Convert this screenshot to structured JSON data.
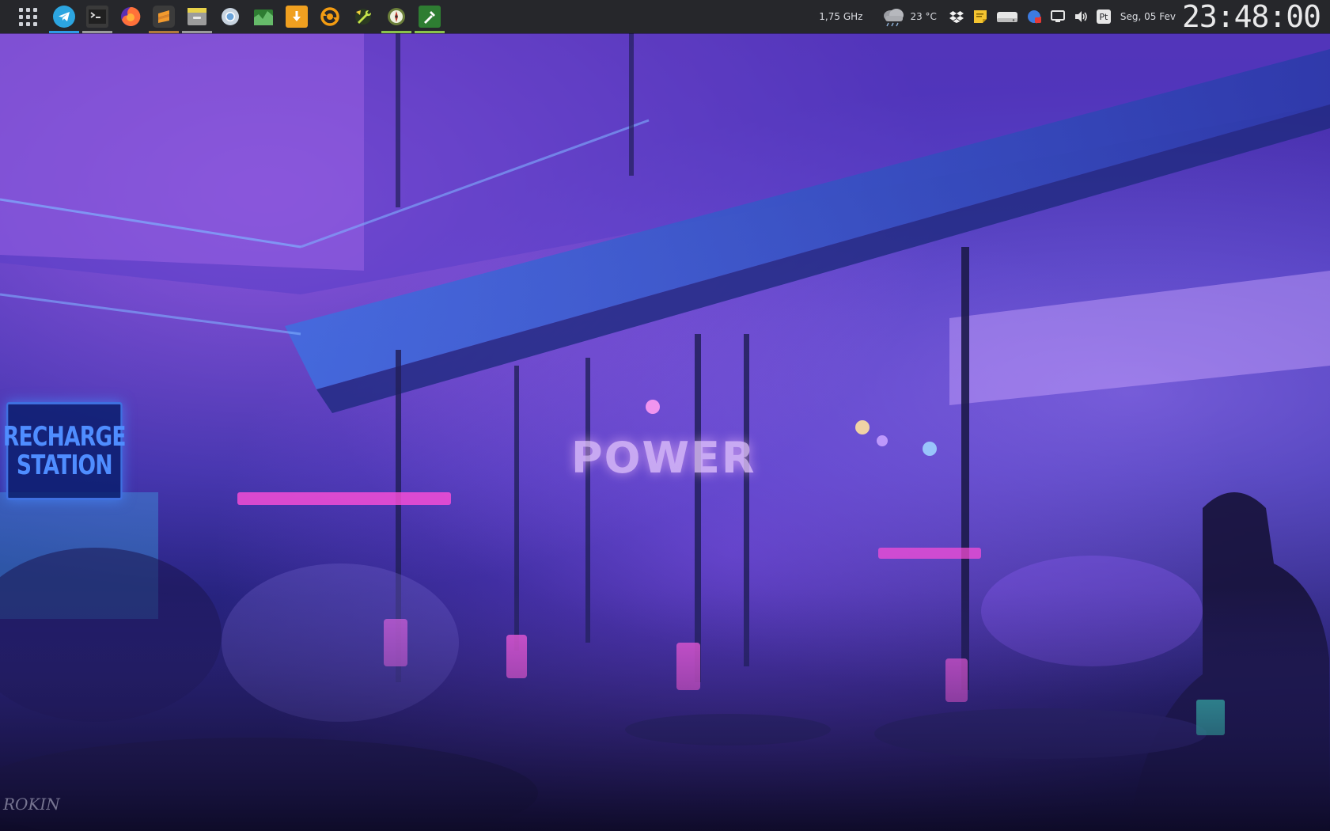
{
  "panel": {
    "launcher_icon": "app-grid-icon",
    "tasks": [
      {
        "name": "telegram",
        "icon": "telegram-icon",
        "color": "#2ca5e0",
        "active": true,
        "indicator": "#2e9be6"
      },
      {
        "name": "terminal",
        "icon": "terminal-icon",
        "color": "#2b2b2b",
        "active": true,
        "indicator": "#9a9a9a"
      },
      {
        "name": "firefox",
        "icon": "firefox-icon",
        "color": "#ff7139",
        "active": false,
        "indicator": "#9a9a9a"
      },
      {
        "name": "sublime-text",
        "icon": "sublime-text-icon",
        "color": "#f29a2e",
        "active": true,
        "indicator": "#b07a3a"
      },
      {
        "name": "file-manager",
        "icon": "file-manager-icon",
        "color": "#9c9c9c",
        "active": true,
        "indicator": "#9a9a9a"
      },
      {
        "name": "chromium",
        "icon": "chromium-icon",
        "color": "#6aa3d9",
        "active": false,
        "indicator": "#9a9a9a"
      },
      {
        "name": "system-monitor",
        "icon": "system-monitor-icon",
        "color": "#4caf50",
        "active": false,
        "indicator": "#9a9a9a"
      },
      {
        "name": "download-manager",
        "icon": "download-icon",
        "color": "#f0a020",
        "active": false,
        "indicator": "#9a9a9a"
      },
      {
        "name": "update-manager",
        "icon": "update-icon",
        "color": "#f39c12",
        "active": false,
        "indicator": "#9a9a9a"
      },
      {
        "name": "wrench-tool",
        "icon": "wrench-icon",
        "color": "#8bc34a",
        "active": false,
        "indicator": "#9a9a9a"
      },
      {
        "name": "compass-app",
        "icon": "compass-icon",
        "color": "#8bc34a",
        "active": true,
        "indicator": "#8bc34a"
      },
      {
        "name": "tools-app",
        "icon": "tools-icon",
        "color": "#2e7d32",
        "active": true,
        "indicator": "#8bc34a"
      }
    ],
    "tray": {
      "cpu_freq": "1,75 GHz",
      "weather_icon": "cloudy-icon",
      "temperature": "23 °C",
      "dropbox_icon": "dropbox-icon",
      "notes_icon": "sticky-notes-icon",
      "drive_icon": "drive-icon",
      "network_icon": "network-icon",
      "display_icon": "display-icon",
      "volume_icon": "volume-icon",
      "keyboard_layout": "Pt",
      "date": "Seg, 05 Fev",
      "time": "23:48:00"
    }
  },
  "wallpaper": {
    "sign_line1": "RECHARGE",
    "sign_line2": "STATION",
    "power_text": "POWER",
    "artist_signature": "ROKIN",
    "colors": {
      "neon_pink": "#ff4fd8",
      "neon_blue": "#4f8dff",
      "deep_purple": "#2c2aa0"
    }
  }
}
